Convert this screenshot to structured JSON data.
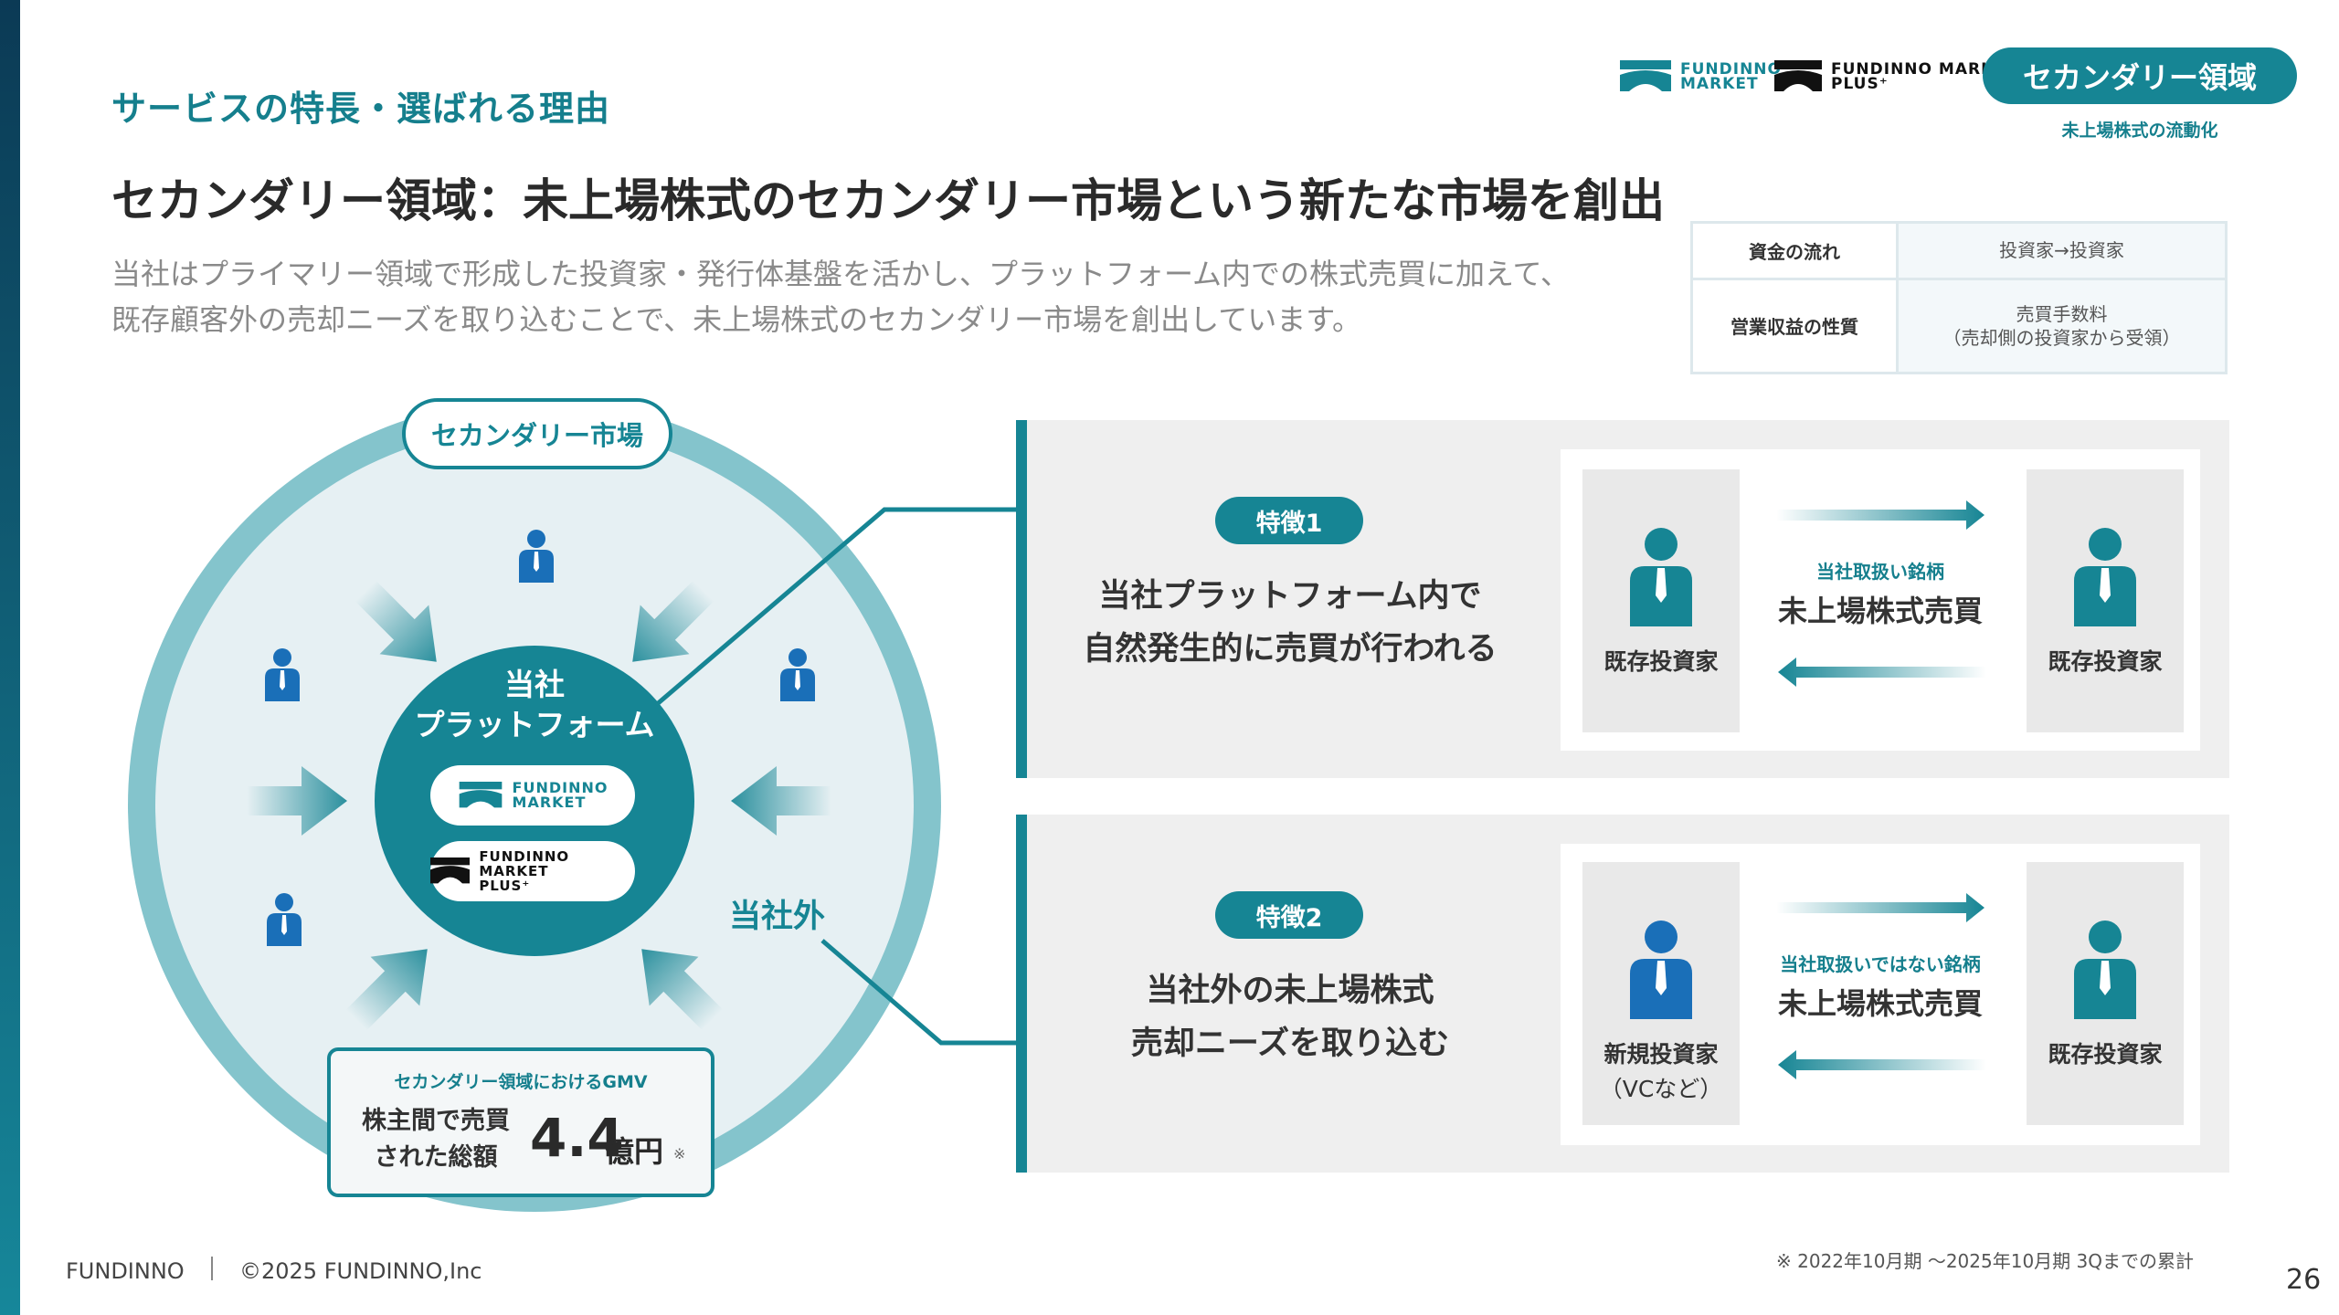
{
  "header": {
    "section_label": "サービスの特長・選ばれる理由",
    "title": "セカンダリー領域：未上場株式のセカンダリー市場という新たな市場を創出",
    "description_line1": "当社はプライマリー領域で形成した投資家・発行体基盤を活かし、プラットフォーム内での株式売買に加えて、",
    "description_line2": "既存顧客外の売却ニーズを取り込むことで、未上場株式のセカンダリー市場を創出しています。",
    "domain_pill": "セカンダリー領域",
    "domain_sub": "未上場株式の流動化"
  },
  "logos": {
    "market_line1": "FUNDINNO",
    "market_line2": "MARKET",
    "plus_line1": "FUNDINNO MARKET",
    "plus_line2": "PLUS⁺"
  },
  "info_table": [
    {
      "header": "資金の流れ",
      "value": "投資家→投資家"
    },
    {
      "header": "営業収益の性質",
      "value": "売買手数料\n（売却側の投資家から受領）"
    }
  ],
  "diagram": {
    "market_tag": "セカンダリー市場",
    "core_title_line1": "当社",
    "core_title_line2": "プラットフォーム",
    "outside_label": "当社外",
    "gmv": {
      "heading": "セカンダリー領域におけるGMV",
      "label_line1": "株主間で売買",
      "label_line2": "された総額",
      "value": "4.4",
      "unit": "億円",
      "note_mark": "※"
    }
  },
  "features": [
    {
      "pill": "特徴1",
      "text_line1": "当社プラットフォーム内で",
      "text_line2": "自然発生的に売買が行われる",
      "left_investor": "既存投資家",
      "left_investor_sub": "",
      "right_investor": "既存投資家",
      "mid_small": "当社取扱い銘柄",
      "mid_big": "未上場株式売買"
    },
    {
      "pill": "特徴2",
      "text_line1": "当社外の未上場株式",
      "text_line2": "売却ニーズを取り込む",
      "left_investor": "新規投資家",
      "left_investor_sub": "（VCなど）",
      "right_investor": "既存投資家",
      "mid_small": "当社取扱いではない銘柄",
      "mid_big": "未上場株式売買"
    }
  ],
  "footer": {
    "brand": "FUNDINNO",
    "copyright": "©2025 FUNDINNO,Inc",
    "footnote": "※ 2022年10月期 ～2025年10月期 3Qまでの累計",
    "page_number": "26"
  },
  "colors": {
    "accent": "#168594",
    "person_blue": "#1a6fb8",
    "ring": "#84c4cc"
  }
}
